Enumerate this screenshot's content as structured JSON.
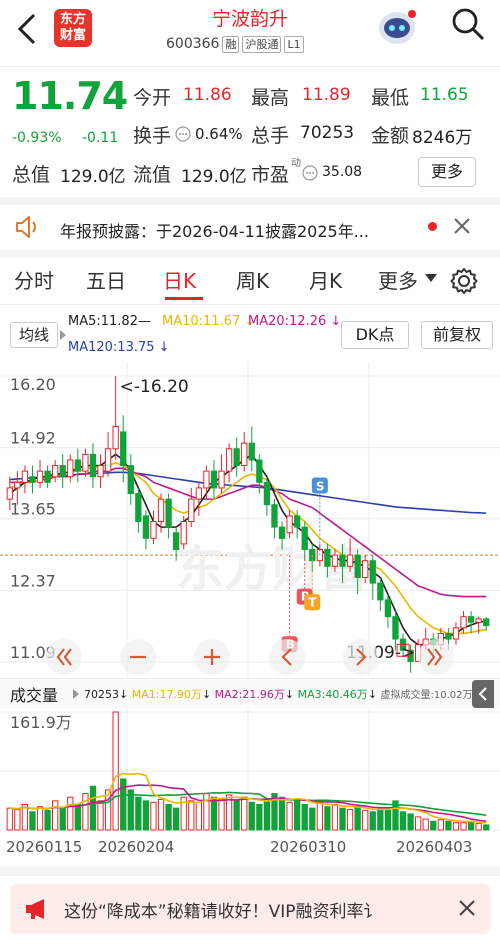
{
  "header": {
    "logo_text": "东方财富",
    "stock_name": "宁波韵升",
    "stock_code": "600366",
    "tags": [
      "融",
      "沪股通",
      "L1"
    ]
  },
  "quote": {
    "price": "11.74",
    "change_pct": "-0.93%",
    "change": "-0.11",
    "open_label": "今开",
    "open": "11.86",
    "high_label": "最高",
    "high": "11.89",
    "low_label": "最低",
    "low": "11.65",
    "turnover_label": "换手",
    "turnover": "0.64%",
    "volume_label": "总手",
    "volume": "70253",
    "amount_label": "金额",
    "amount": "8246万",
    "mktcap_label": "总值",
    "mktcap": "129.0亿",
    "float_label": "流值",
    "float_cap": "129.0亿",
    "pe_label": "市盈",
    "pe_sup": "动",
    "pe": "35.08",
    "more_label": "更多"
  },
  "notice": {
    "text": "年报预披露：于2026-04-11披露2025年..."
  },
  "tabs": [
    "分时",
    "五日",
    "日K",
    "周K",
    "月K",
    "更多"
  ],
  "active_tab": "日K",
  "ma_bar": {
    "button": "均线",
    "ma5": "MA5:11.82",
    "ma10": "MA10:11.67",
    "ma20": "MA20:12.26",
    "ma120": "MA120:13.75",
    "dk_button": "DK点",
    "fq_button": "前复权"
  },
  "chart_data": {
    "type": "candlestick",
    "y_ticks": [
      "16.20",
      "14.92",
      "13.65",
      "12.37",
      "11.09"
    ],
    "ylim": [
      11.09,
      16.2
    ],
    "max_annotation": "<-16.20",
    "min_annotation": "11.09->",
    "markers": [
      "S",
      "B",
      "B",
      "T"
    ],
    "dates": [
      "20260115",
      "20260204",
      "20260310",
      "20260403"
    ],
    "candles": [
      [
        14.0,
        14.2,
        13.8,
        14.4
      ],
      [
        14.2,
        14.3,
        13.9,
        14.5
      ],
      [
        14.3,
        14.5,
        14.1,
        14.6
      ],
      [
        14.4,
        14.3,
        14.1,
        14.6
      ],
      [
        14.3,
        14.5,
        14.2,
        14.7
      ],
      [
        14.5,
        14.3,
        14.2,
        14.6
      ],
      [
        14.4,
        14.6,
        14.3,
        14.7
      ],
      [
        14.6,
        14.4,
        14.2,
        14.8
      ],
      [
        14.4,
        14.7,
        14.3,
        14.8
      ],
      [
        14.7,
        14.5,
        14.3,
        14.9
      ],
      [
        14.5,
        14.8,
        14.4,
        14.9
      ],
      [
        14.8,
        14.4,
        14.2,
        15.0
      ],
      [
        14.4,
        14.6,
        14.2,
        14.8
      ],
      [
        14.5,
        14.9,
        14.4,
        15.2
      ],
      [
        14.9,
        15.3,
        14.7,
        16.2
      ],
      [
        15.2,
        14.6,
        14.3,
        15.5
      ],
      [
        14.6,
        14.1,
        13.9,
        14.8
      ],
      [
        14.1,
        13.6,
        13.4,
        14.2
      ],
      [
        13.7,
        13.3,
        13.1,
        13.8
      ],
      [
        13.3,
        13.6,
        13.2,
        13.8
      ],
      [
        13.6,
        14.0,
        13.4,
        14.1
      ],
      [
        14.0,
        13.5,
        13.3,
        14.1
      ],
      [
        13.4,
        13.1,
        12.9,
        13.5
      ],
      [
        13.2,
        13.6,
        13.1,
        13.7
      ],
      [
        13.6,
        14.0,
        13.5,
        14.2
      ],
      [
        14.0,
        14.2,
        13.7,
        14.3
      ],
      [
        14.2,
        14.5,
        14.0,
        14.6
      ],
      [
        14.5,
        14.2,
        14.0,
        14.7
      ],
      [
        14.2,
        14.5,
        14.1,
        14.8
      ],
      [
        14.5,
        14.9,
        14.3,
        15.0
      ],
      [
        14.9,
        14.6,
        14.4,
        15.1
      ],
      [
        14.6,
        15.0,
        14.5,
        15.2
      ],
      [
        15.0,
        14.7,
        14.5,
        15.3
      ],
      [
        14.7,
        14.3,
        14.1,
        14.8
      ],
      [
        14.3,
        13.9,
        13.7,
        14.4
      ],
      [
        13.9,
        13.5,
        13.3,
        14.0
      ],
      [
        13.5,
        13.3,
        13.1,
        13.6
      ],
      [
        13.4,
        13.7,
        13.3,
        13.8
      ],
      [
        13.7,
        13.5,
        13.3,
        13.8
      ],
      [
        13.5,
        13.1,
        12.9,
        13.6
      ],
      [
        13.1,
        12.9,
        12.7,
        13.2
      ],
      [
        12.9,
        13.1,
        12.8,
        13.2
      ],
      [
        13.1,
        12.8,
        12.6,
        13.2
      ],
      [
        12.8,
        13.0,
        12.7,
        13.1
      ],
      [
        13.0,
        12.8,
        12.5,
        13.2
      ],
      [
        12.8,
        13.0,
        12.7,
        13.3
      ],
      [
        13.0,
        12.6,
        12.3,
        13.1
      ],
      [
        12.6,
        12.9,
        12.5,
        13.0
      ],
      [
        12.9,
        12.5,
        12.2,
        13.0
      ],
      [
        12.5,
        12.2,
        12.0,
        12.6
      ],
      [
        12.2,
        11.9,
        11.7,
        12.3
      ],
      [
        11.9,
        11.5,
        11.3,
        12.0
      ],
      [
        11.5,
        11.3,
        11.2,
        11.6
      ],
      [
        11.3,
        11.1,
        10.9,
        11.4
      ],
      [
        11.1,
        11.4,
        11.09,
        11.5
      ],
      [
        11.4,
        11.5,
        11.3,
        11.7
      ],
      [
        11.5,
        11.4,
        11.2,
        11.6
      ],
      [
        11.4,
        11.6,
        11.3,
        11.7
      ],
      [
        11.6,
        11.5,
        11.3,
        11.7
      ],
      [
        11.5,
        11.7,
        11.4,
        11.8
      ],
      [
        11.7,
        11.9,
        11.6,
        12.0
      ],
      [
        11.9,
        11.8,
        11.6,
        12.0
      ],
      [
        11.8,
        11.86,
        11.6,
        11.9
      ],
      [
        11.86,
        11.74,
        11.65,
        11.89
      ]
    ],
    "ma5": [
      14.1,
      14.2,
      14.3,
      14.35,
      14.4,
      14.4,
      14.45,
      14.45,
      14.5,
      14.55,
      14.6,
      14.6,
      14.6,
      14.7,
      14.8,
      14.7,
      14.5,
      14.2,
      13.9,
      13.6,
      13.5,
      13.5,
      13.5,
      13.6,
      13.7,
      13.9,
      14.1,
      14.3,
      14.4,
      14.5,
      14.6,
      14.7,
      14.8,
      14.6,
      14.4,
      14.1,
      13.8,
      13.6,
      13.5,
      13.4,
      13.2,
      13.1,
      13.0,
      12.95,
      12.9,
      12.9,
      12.85,
      12.8,
      12.7,
      12.6,
      12.3,
      12.0,
      11.7,
      11.5,
      11.4,
      11.4,
      11.45,
      11.5,
      11.55,
      11.6,
      11.7,
      11.75,
      11.8,
      11.82
    ],
    "ma10": [
      14.2,
      14.25,
      14.3,
      14.3,
      14.35,
      14.4,
      14.4,
      14.45,
      14.5,
      14.5,
      14.55,
      14.55,
      14.6,
      14.6,
      14.65,
      14.6,
      14.5,
      14.4,
      14.3,
      14.1,
      14.0,
      13.9,
      13.8,
      13.75,
      13.8,
      13.85,
      13.9,
      14.0,
      14.1,
      14.2,
      14.3,
      14.4,
      14.45,
      14.4,
      14.35,
      14.2,
      14.0,
      13.8,
      13.7,
      13.6,
      13.45,
      13.3,
      13.2,
      13.1,
      13.0,
      12.95,
      12.9,
      12.85,
      12.8,
      12.75,
      12.6,
      12.45,
      12.25,
      12.05,
      11.9,
      11.8,
      11.7,
      11.65,
      11.6,
      11.6,
      11.6,
      11.62,
      11.65,
      11.67
    ],
    "ma20": [
      14.3,
      14.3,
      14.3,
      14.3,
      14.35,
      14.35,
      14.4,
      14.4,
      14.4,
      14.45,
      14.45,
      14.5,
      14.5,
      14.5,
      14.55,
      14.55,
      14.5,
      14.45,
      14.4,
      14.3,
      14.25,
      14.2,
      14.15,
      14.1,
      14.05,
      14.0,
      14.0,
      14.0,
      14.05,
      14.1,
      14.15,
      14.2,
      14.25,
      14.25,
      14.2,
      14.15,
      14.1,
      14.0,
      13.95,
      13.9,
      13.85,
      13.75,
      13.65,
      13.55,
      13.45,
      13.35,
      13.25,
      13.15,
      13.05,
      12.95,
      12.85,
      12.75,
      12.65,
      12.55,
      12.45,
      12.4,
      12.35,
      12.3,
      12.28,
      12.27,
      12.26,
      12.26,
      12.26,
      12.26
    ],
    "ma120": [
      14.35,
      14.36,
      14.37,
      14.38,
      14.39,
      14.4,
      14.41,
      14.42,
      14.43,
      14.44,
      14.45,
      14.46,
      14.46,
      14.47,
      14.48,
      14.48,
      14.47,
      14.46,
      14.44,
      14.42,
      14.4,
      14.38,
      14.36,
      14.34,
      14.32,
      14.3,
      14.28,
      14.27,
      14.26,
      14.25,
      14.24,
      14.23,
      14.22,
      14.21,
      14.2,
      14.18,
      14.16,
      14.14,
      14.12,
      14.1,
      14.08,
      14.06,
      14.04,
      14.02,
      14.0,
      13.98,
      13.96,
      13.94,
      13.92,
      13.9,
      13.88,
      13.86,
      13.85,
      13.84,
      13.83,
      13.82,
      13.81,
      13.8,
      13.79,
      13.78,
      13.77,
      13.76,
      13.755,
      13.75
    ]
  },
  "nav_icons": [
    "double-chevron-left-icon",
    "minus-icon",
    "plus-icon",
    "chevron-left-icon",
    "chevron-right-icon",
    "double-chevron-right-icon"
  ],
  "volume_panel": {
    "button": "成交量",
    "vol": "70253",
    "ma1": "MA1:17.90万",
    "ma2": "MA2:21.96万",
    "ma3": "MA3:40.46万",
    "virtual": "虚拟成交量:10.02万",
    "max_label": "161.9万",
    "volumes": [
      30,
      28,
      35,
      25,
      32,
      27,
      40,
      30,
      45,
      35,
      50,
      60,
      40,
      55,
      161.9,
      70,
      55,
      45,
      40,
      38,
      42,
      35,
      30,
      45,
      40,
      38,
      50,
      45,
      42,
      48,
      40,
      45,
      38,
      35,
      40,
      50,
      45,
      38,
      42,
      35,
      30,
      38,
      32,
      35,
      30,
      28,
      32,
      27,
      25,
      30,
      28,
      40,
      25,
      22,
      18,
      15,
      12,
      14,
      12,
      10,
      10,
      12,
      9,
      7
    ]
  },
  "ad": {
    "text": "这份“降成本”秘籍请收好！VIP融资利率讠"
  },
  "colors": {
    "up": "#e8242b",
    "down": "#10a33a",
    "ma5": "#222222",
    "ma10": "#e8b800",
    "ma20": "#c2188a",
    "ma120": "#2a3fa8"
  }
}
